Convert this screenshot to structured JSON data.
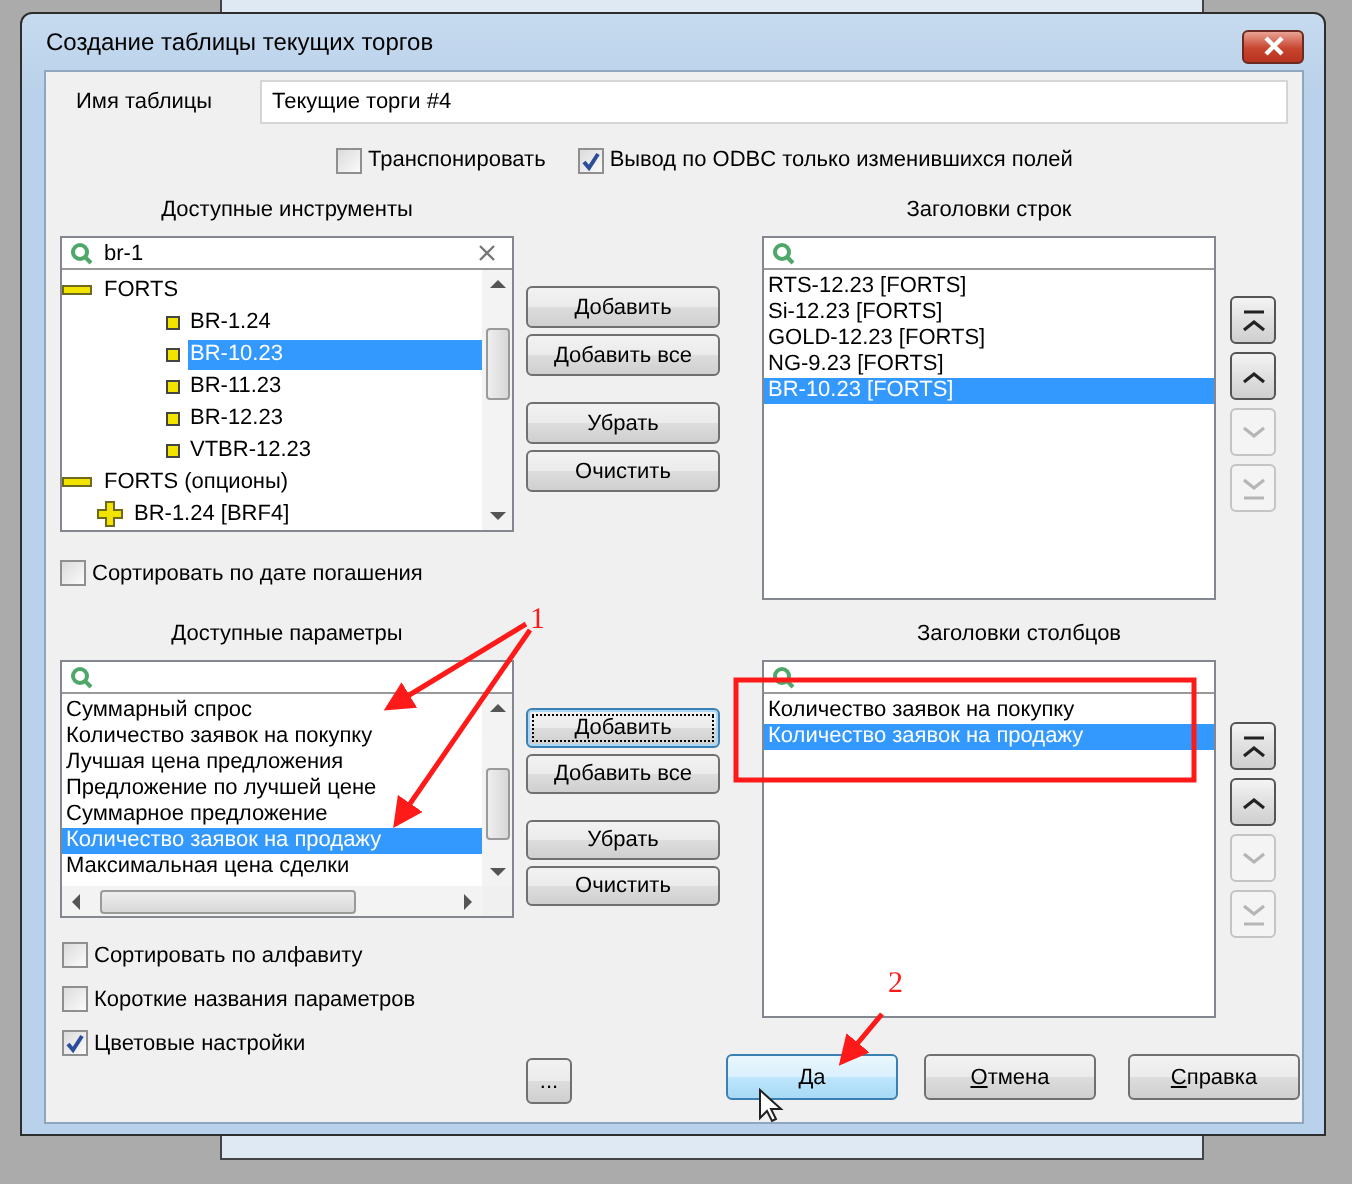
{
  "window": {
    "title": "Создание таблицы текущих торгов"
  },
  "table_name": {
    "label": "Имя таблицы",
    "value": "Текущие торги #4"
  },
  "options": [
    {
      "label": "Транспонировать",
      "checked": false
    },
    {
      "label": "Вывод по ODBC только изменившихся  полей",
      "checked": true
    }
  ],
  "instruments": {
    "heading": "Доступные инструменты",
    "search": "br-1",
    "tree": [
      {
        "label": "FORTS",
        "expanded": true,
        "selected": false,
        "children": [
          {
            "label": "BR-1.24",
            "selected": false
          },
          {
            "label": "BR-10.23",
            "selected": true
          },
          {
            "label": "BR-11.23",
            "selected": false
          },
          {
            "label": "BR-12.23",
            "selected": false
          },
          {
            "label": "VTBR-12.23",
            "selected": false
          }
        ]
      },
      {
        "label": "FORTS (опционы)",
        "expanded": true,
        "selected": false,
        "children": [
          {
            "label": "BR-1.24 [BRF4]",
            "expanded": false,
            "selected": false
          }
        ]
      }
    ]
  },
  "sort_by_expiry": {
    "label": "Сортировать по дате погашения",
    "checked": false
  },
  "instrument_buttons": [
    {
      "label": "Добавить",
      "focused": false
    },
    {
      "label": "Добавить все",
      "focused": false
    },
    {
      "label": "Убрать",
      "focused": false
    },
    {
      "label": "Очистить",
      "focused": false
    }
  ],
  "row_headers": {
    "heading": "Заголовки строк",
    "items": [
      {
        "label": "RTS-12.23 [FORTS]",
        "selected": false
      },
      {
        "label": "Si-12.23 [FORTS]",
        "selected": false
      },
      {
        "label": "GOLD-12.23 [FORTS]",
        "selected": false
      },
      {
        "label": "NG-9.23 [FORTS]",
        "selected": false
      },
      {
        "label": "BR-10.23 [FORTS]",
        "selected": true
      }
    ]
  },
  "row_order_buttons": [
    {
      "kind": "top",
      "disabled": false
    },
    {
      "kind": "up",
      "disabled": false
    },
    {
      "kind": "down",
      "disabled": true
    },
    {
      "kind": "bottom",
      "disabled": true
    }
  ],
  "parameters": {
    "heading": "Доступные параметры",
    "items": [
      {
        "label": "Суммарный спрос",
        "selected": false
      },
      {
        "label": "Количество заявок на покупку",
        "selected": false
      },
      {
        "label": "Лучшая цена предложения",
        "selected": false
      },
      {
        "label": "Предложение по лучшей цене",
        "selected": false
      },
      {
        "label": "Суммарное предложение",
        "selected": false
      },
      {
        "label": "Количество заявок на продажу",
        "selected": true
      },
      {
        "label": "Максимальная цена сделки",
        "selected": false
      }
    ]
  },
  "parameter_buttons": [
    {
      "label": "Добавить",
      "focused": true
    },
    {
      "label": "Добавить все",
      "focused": false
    },
    {
      "label": "Убрать",
      "focused": false
    },
    {
      "label": "Очистить",
      "focused": false
    }
  ],
  "column_headers": {
    "heading": "Заголовки столбцов",
    "items": [
      {
        "label": "Количество заявок на покупку",
        "selected": false
      },
      {
        "label": "Количество заявок на продажу",
        "selected": true
      }
    ]
  },
  "column_order_buttons": [
    {
      "kind": "top",
      "disabled": false
    },
    {
      "kind": "up",
      "disabled": false
    },
    {
      "kind": "down",
      "disabled": true
    },
    {
      "kind": "bottom",
      "disabled": true
    }
  ],
  "parameter_options": [
    {
      "label": "Сортировать по алфавиту",
      "checked": false
    },
    {
      "label": "Короткие названия параметров",
      "checked": false
    },
    {
      "label": "Цветовые настройки",
      "checked": true
    }
  ],
  "more_button": {
    "label": "..."
  },
  "footer_buttons": [
    {
      "label": "Да",
      "hovered": true
    },
    {
      "label": "Отмена",
      "hovered": false
    },
    {
      "label": "Справка",
      "hovered": false
    }
  ],
  "annotations": [
    {
      "label": "1"
    },
    {
      "label": "2"
    }
  ]
}
